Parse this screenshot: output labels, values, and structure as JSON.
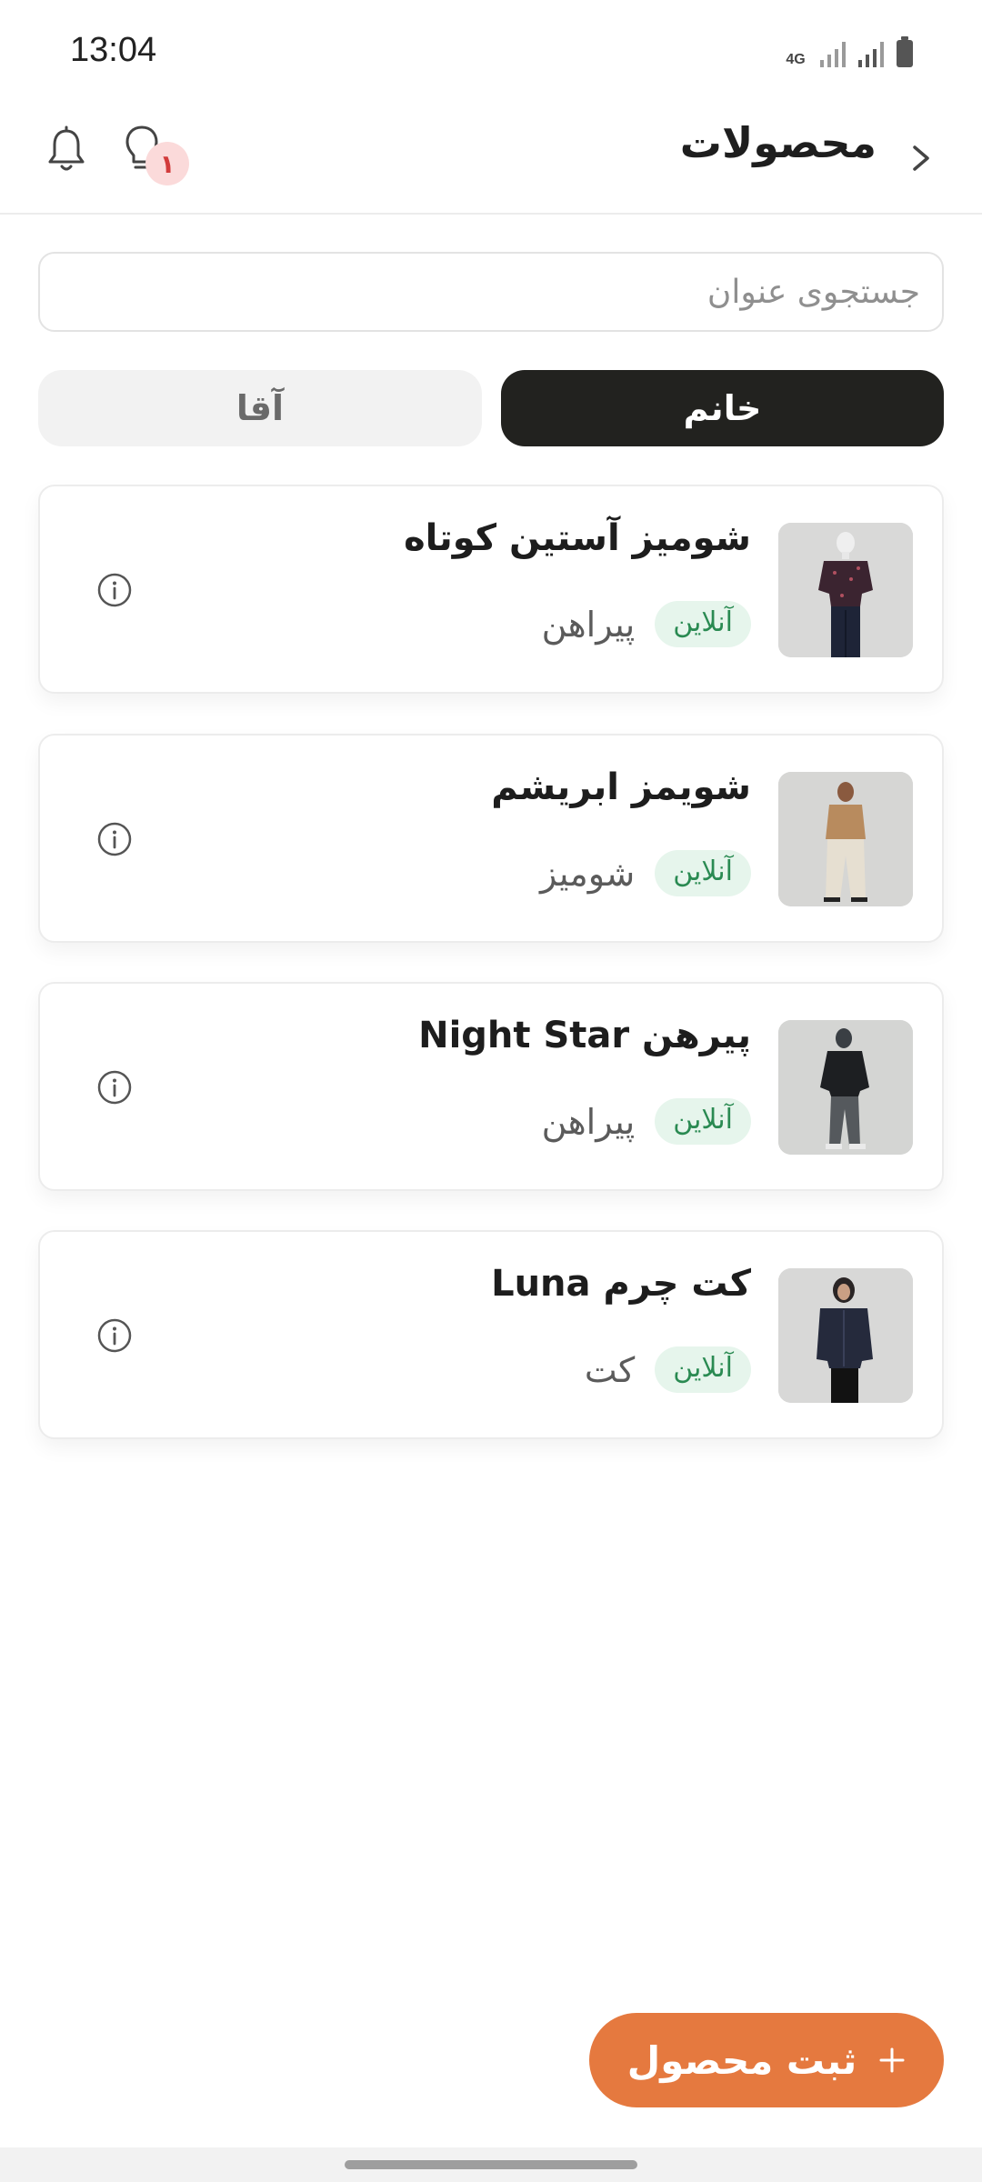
{
  "status_bar": {
    "time": "13:04",
    "network": "4G"
  },
  "header": {
    "title": "محصولات",
    "notification_count": "۱"
  },
  "search": {
    "placeholder": "جستجوی عنوان",
    "value": ""
  },
  "tabs": [
    {
      "label": "خانم",
      "selected": true
    },
    {
      "label": "آقا",
      "selected": false
    }
  ],
  "products": [
    {
      "name": "شومیز آستین کوتاه",
      "category": "پیراهن",
      "status": "آنلاین"
    },
    {
      "name": "شویمز ابریشم",
      "category": "شومیز",
      "status": "آنلاین"
    },
    {
      "name": "پیرهن Night Star",
      "category": "پیراهن",
      "status": "آنلاین"
    },
    {
      "name": "کت چرم Luna",
      "category": "کت",
      "status": "آنلاین"
    }
  ],
  "fab": {
    "label": "ثبت محصول"
  },
  "colors": {
    "accent": "#e5793f",
    "selected_tab": "#22221f",
    "status_green": "#2a8a52",
    "status_green_bg": "#e6f5ec",
    "badge_bg": "#fbdada",
    "badge_text": "#d23b3b"
  },
  "icons": {
    "back": "chevron-right-icon",
    "notifications": "bell-icon",
    "tips": "lightbulb-icon",
    "info": "info-icon",
    "add": "plus-icon"
  }
}
